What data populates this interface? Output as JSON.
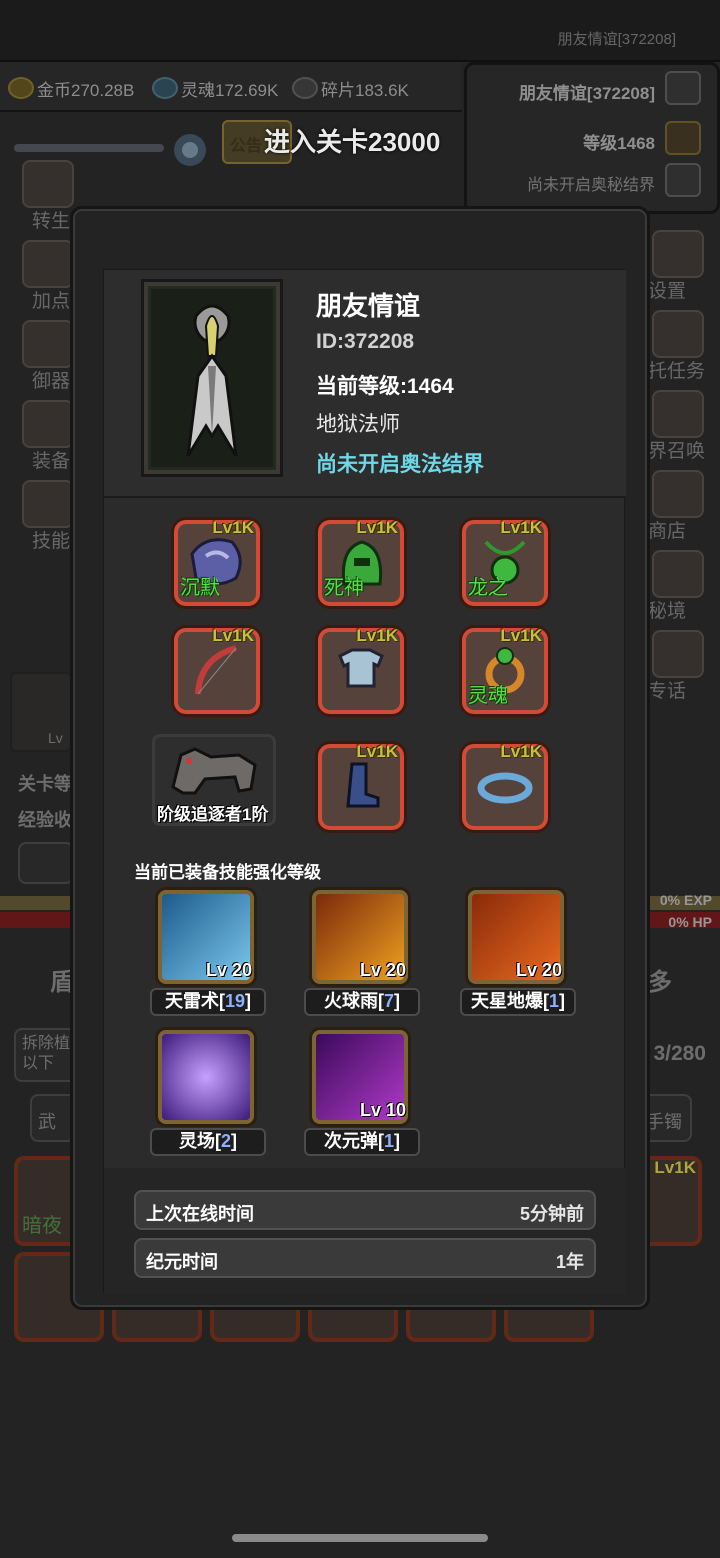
{
  "top_bar": {
    "title": "朋友情谊[372208]"
  },
  "resources": [
    {
      "icon": "gold-coin-icon",
      "label": "金币270.28B"
    },
    {
      "icon": "soul-icon",
      "label": "灵魂172.69K"
    },
    {
      "icon": "shard-icon",
      "label": "碎片183.6K"
    }
  ],
  "player_panel": {
    "name": "朋友情谊[372208]",
    "level": "等级1468",
    "realm": "尚未开启奥秘结界"
  },
  "stage_banner": "进入关卡23000",
  "notice_tab": "公告",
  "left_menu": [
    "转生",
    "加点",
    "御器",
    "装备",
    "技能"
  ],
  "right_menu": [
    "设置",
    "托任务",
    "界召唤",
    "商店",
    "秘境",
    "专话"
  ],
  "bg_labels": {
    "stage": "关卡等",
    "exp_gain": "经验收",
    "exp_pct": "0% EXP",
    "hp_pct": "0% HP",
    "tab_left": "盾",
    "tab_right": "多",
    "dismantle": "拆除植以下",
    "weapon_tab": "武",
    "bracelet_tab": "手镯",
    "bag_count": "3/280",
    "bag_first_label": "暗夜",
    "bag_first_lv": "Lv",
    "bag_right_lv": "Lv1K",
    "pet_lv": "Lv"
  },
  "profile": {
    "name": "朋友情谊",
    "id": "ID:372208",
    "level": "当前等级:1464",
    "class": "地狱法师",
    "realm": "尚未开启奥法结界"
  },
  "equipment": [
    {
      "lv": "Lv1K",
      "name": "沉默",
      "icon": "gauntlet-icon"
    },
    {
      "lv": "Lv1K",
      "name": "死神",
      "icon": "helmet-icon"
    },
    {
      "lv": "Lv1K",
      "name": "龙之",
      "icon": "amulet-icon"
    },
    {
      "lv": "Lv1K",
      "name": "",
      "icon": "bow-icon"
    },
    {
      "lv": "Lv1K",
      "name": "",
      "icon": "chest-armor-icon"
    },
    {
      "lv": "Lv1K",
      "name": "灵魂",
      "icon": "ring-icon"
    },
    {
      "lv": "Lv1K",
      "name": "",
      "icon": "boots-icon"
    },
    {
      "lv": "Lv1K",
      "name": "",
      "icon": "bracelet-icon"
    }
  ],
  "pet": {
    "name": "阶级追逐者1阶",
    "icon": "wolf-icon"
  },
  "skills_title": "当前已装备技能强化等级",
  "skills": [
    {
      "name": "天雷术",
      "count": "19",
      "lv": "Lv 20",
      "icon": "lightning-icon"
    },
    {
      "name": "火球雨",
      "count": "7",
      "lv": "Lv 20",
      "icon": "fireball-icon"
    },
    {
      "name": "天星地爆",
      "count": "1",
      "lv": "Lv 20",
      "icon": "meteor-icon"
    },
    {
      "name": "灵场",
      "count": "2",
      "lv": "",
      "icon": "vortex-icon"
    },
    {
      "name": "次元弹",
      "count": "1",
      "lv": "Lv 10",
      "icon": "dimension-bolt-icon"
    }
  ],
  "info": [
    {
      "key": "上次在线时间",
      "value": "5分钟前"
    },
    {
      "key": "纪元时间",
      "value": "1年"
    }
  ]
}
